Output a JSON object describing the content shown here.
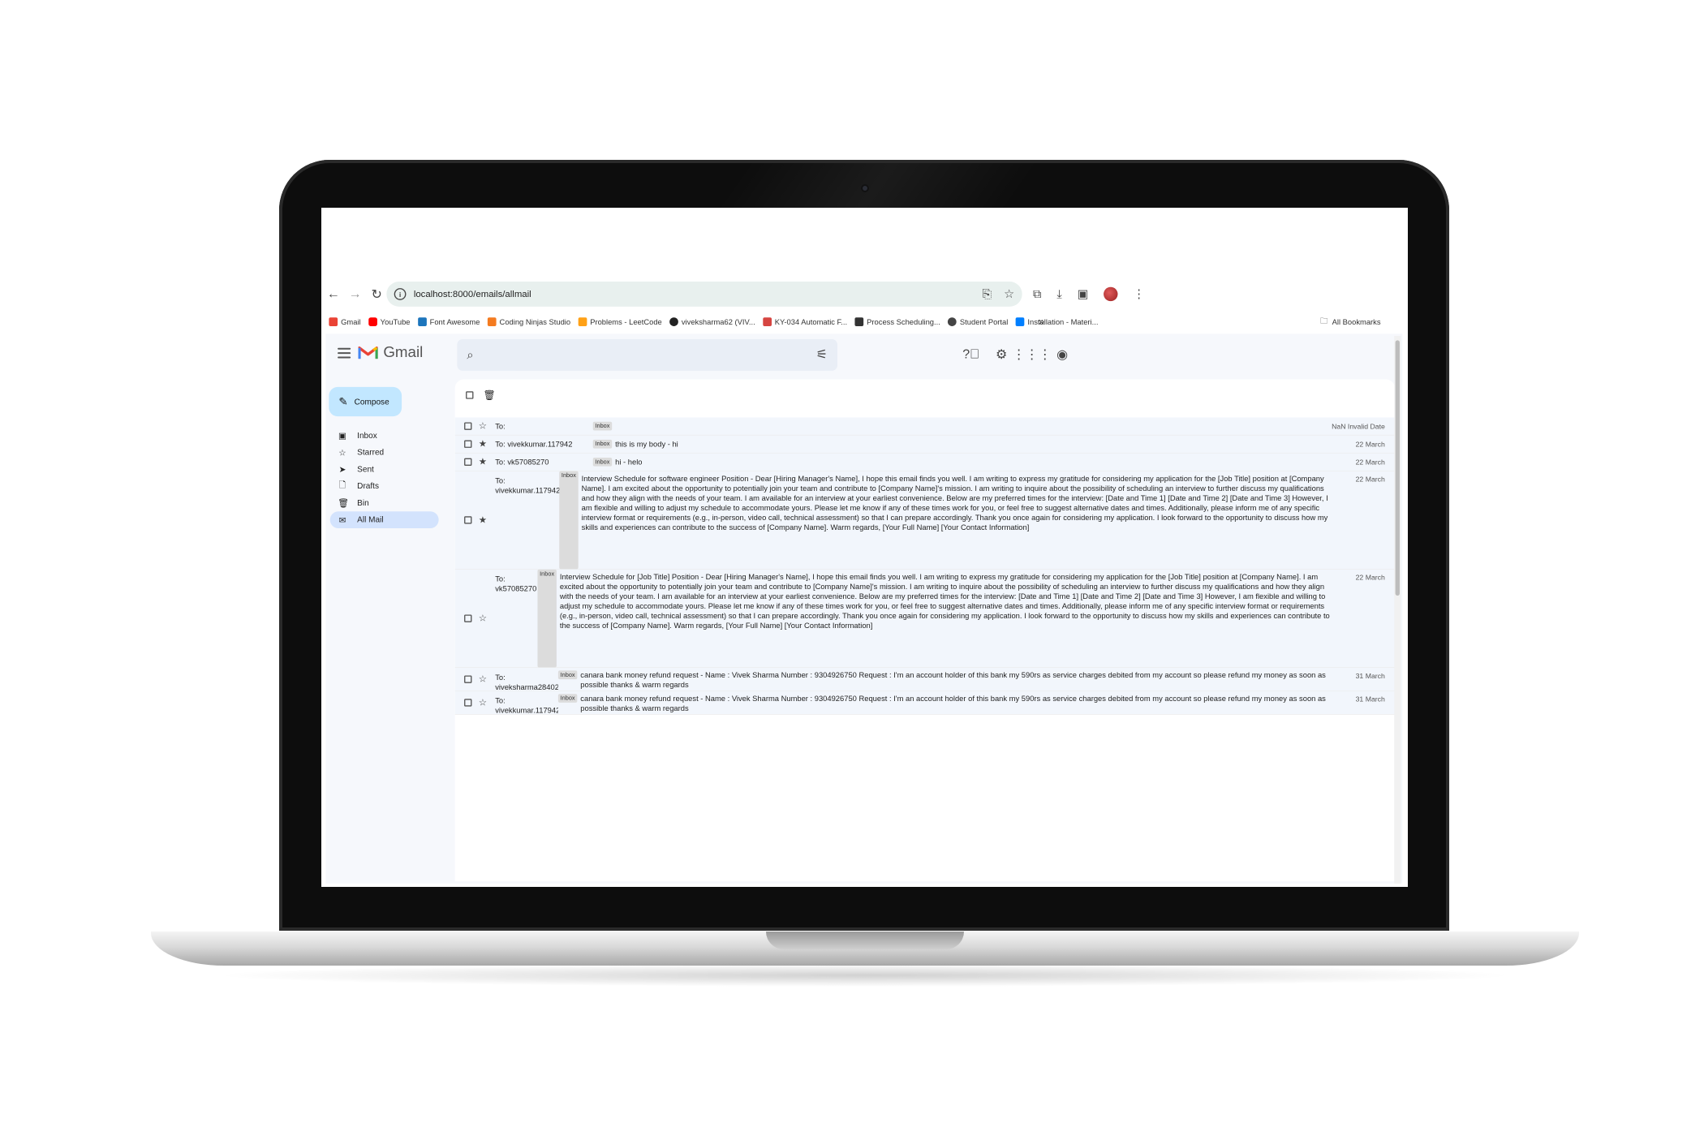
{
  "browser": {
    "url": "localhost:8000/emails/allmail",
    "bookmarks": [
      {
        "label": "Gmail",
        "icon": "gmail-icon",
        "color": "#ea4335"
      },
      {
        "label": "YouTube",
        "icon": "youtube-icon",
        "color": "#ff0000"
      },
      {
        "label": "Font Awesome",
        "icon": "flag-icon",
        "color": "#1c75bc"
      },
      {
        "label": "Coding Ninjas Studio",
        "icon": "coding-ninjas-icon",
        "color": "#f47b20"
      },
      {
        "label": "Problems - LeetCode",
        "icon": "leetcode-icon",
        "color": "#ffa116"
      },
      {
        "label": "viveksharma62 (VIV...",
        "icon": "github-icon",
        "color": "#222222"
      },
      {
        "label": "KY-034 Automatic F...",
        "icon": "ky034-icon",
        "color": "#d64541"
      },
      {
        "label": "Process Scheduling...",
        "icon": "process-scheduling-icon",
        "color": "#333333"
      },
      {
        "label": "Student Portal",
        "icon": "globe-icon",
        "color": "#444444"
      },
      {
        "label": "Installation - Materi...",
        "icon": "materialui-icon",
        "color": "#007fff"
      }
    ],
    "all_bookmarks_label": "All Bookmarks"
  },
  "gmail": {
    "brand": "Gmail",
    "search_placeholder": "",
    "compose_label": "Compose",
    "nav": [
      {
        "label": "Inbox",
        "icon": "inbox-icon"
      },
      {
        "label": "Starred",
        "icon": "star-icon"
      },
      {
        "label": "Sent",
        "icon": "send-icon"
      },
      {
        "label": "Drafts",
        "icon": "draft-icon"
      },
      {
        "label": "Bin",
        "icon": "trash-icon"
      },
      {
        "label": "All Mail",
        "icon": "mail-icon",
        "active": true
      }
    ],
    "emails": [
      {
        "to": "To:",
        "label": "Inbox",
        "body": "",
        "date": "NaN Invalid Date",
        "starred": false
      },
      {
        "to": "To: vivekkumar.117942",
        "label": "Inbox",
        "body": "this is my body - hi",
        "date": "22 March",
        "starred": true
      },
      {
        "to": "To: vk57085270",
        "label": "Inbox",
        "body": "hi - helo",
        "date": "22 March",
        "starred": true
      },
      {
        "to": "To: vivekkumar.117942",
        "label": "Inbox",
        "body": "Interview Schedule for software engineer Position - Dear [Hiring Manager's Name], I hope this email finds you well. I am writing to express my gratitude for considering my application for the [Job Title] position at [Company Name]. I am excited about the opportunity to potentially join your team and contribute to [Company Name]'s mission. I am writing to inquire about the possibility of scheduling an interview to further discuss my qualifications and how they align with the needs of your team. I am available for an interview at your earliest convenience. Below are my preferred times for the interview: [Date and Time 1] [Date and Time 2] [Date and Time 3] However, I am flexible and willing to adjust my schedule to accommodate yours. Please let me know if any of these times work for you, or feel free to suggest alternative dates and times. Additionally, please inform me of any specific interview format or requirements (e.g., in-person, video call, technical assessment) so that I can prepare accordingly. Thank you once again for considering my application. I look forward to the opportunity to discuss how my skills and experiences can contribute to the success of [Company Name]. Warm regards, [Your Full Name] [Your Contact Information]",
        "date": "22 March",
        "starred": true
      },
      {
        "to": "To: vk57085270",
        "label": "Inbox",
        "body": "Interview Schedule for [Job Title] Position - Dear [Hiring Manager's Name], I hope this email finds you well. I am writing to express my gratitude for considering my application for the [Job Title] position at [Company Name]. I am excited about the opportunity to potentially join your team and contribute to [Company Name]'s mission. I am writing to inquire about the possibility of scheduling an interview to further discuss my qualifications and how they align with the needs of your team. I am available for an interview at your earliest convenience. Below are my preferred times for the interview: [Date and Time 1] [Date and Time 2] [Date and Time 3] However, I am flexible and willing to adjust my schedule to accommodate yours. Please let me know if any of these times work for you, or feel free to suggest alternative dates and times. Additionally, please inform me of any specific interview format or requirements (e.g., in-person, video call, technical assessment) so that I can prepare accordingly. Thank you once again for considering my application. I look forward to the opportunity to discuss how my skills and experiences can contribute to the success of [Company Name]. Warm regards, [Your Full Name] [Your Contact Information]",
        "date": "22 March",
        "starred": false
      },
      {
        "to": "To: viveksharma28402",
        "label": "Inbox",
        "body": "canara bank money refund request - Name : Vivek Sharma Number : 9304926750 Request : I'm an account holder of this bank my 590rs as service charges debited from my account so please refund my money as soon as possible thanks & warm regards",
        "date": "31 March",
        "starred": false
      },
      {
        "to": "To: vivekkumar.117942",
        "label": "Inbox",
        "body": "canara bank money refund request - Name : Vivek Sharma Number : 9304926750 Request : I'm an account holder of this bank my 590rs as service charges debited from my account so please refund my money as soon as possible thanks & warm regards",
        "date": "31 March",
        "starred": false
      }
    ]
  },
  "colors": {
    "app_bg": "#f6f8fc",
    "compose_bg": "#c2e7ff",
    "nav_active_bg": "#d3e3fd",
    "search_bg": "#e9eef6",
    "omnibox_bg": "#e8f0ee",
    "badge_bg": "#dcdcdc"
  }
}
